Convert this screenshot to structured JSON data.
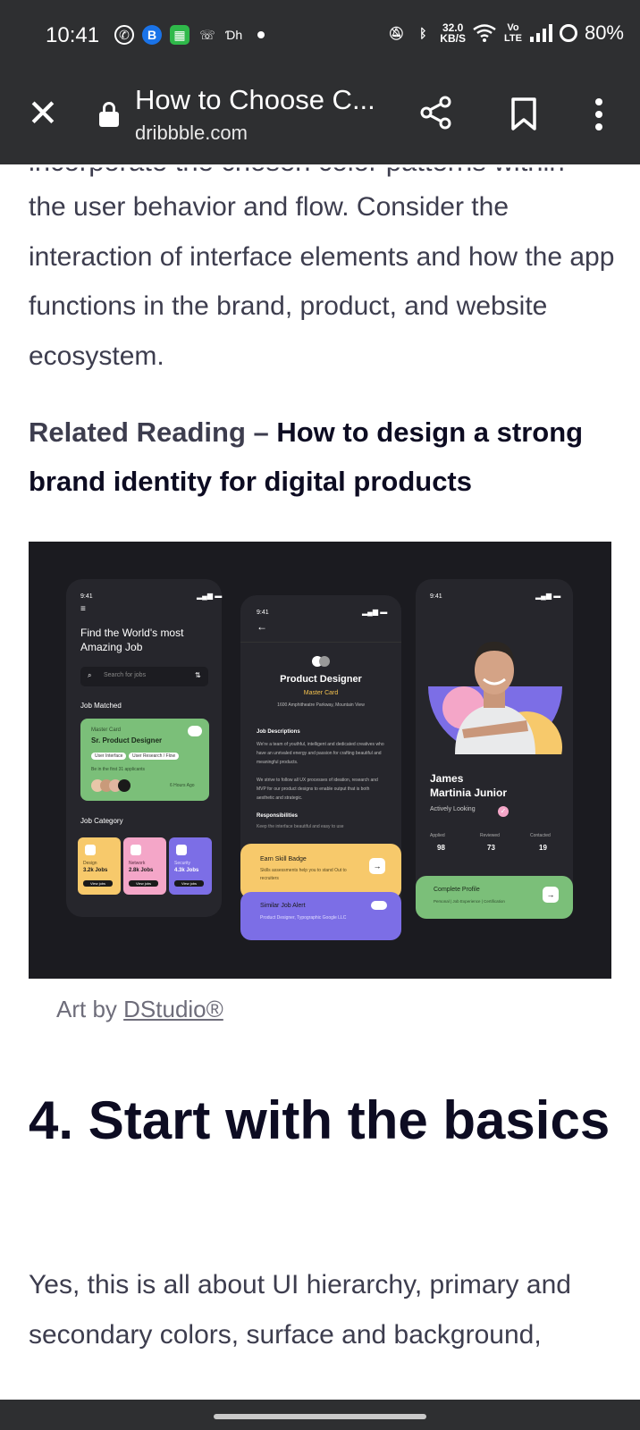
{
  "status_bar": {
    "time": "10:41",
    "speed_value": "32.0",
    "speed_unit": "KB/S",
    "network_label": "Vo LTE",
    "battery": "80%",
    "icons_left": [
      "whatsapp-icon",
      "b-app-icon",
      "calculator-icon",
      "phone-icon",
      "dh-icon"
    ],
    "dh_text": "Ɗh"
  },
  "toolbar": {
    "close_icon": "close-icon",
    "page_title": "How to Choose C...",
    "url": "dribbble.com"
  },
  "article": {
    "cut_line": "incorporate the chosen color patterns within",
    "para1": "the user behavior and flow. Consider the interaction of interface elements and how the app functions in the brand, product, and website ecosystem.",
    "related_prefix": "Related Reading – ",
    "related_link": "How to design a strong brand identity for digital products",
    "caption_prefix": "Art by ",
    "caption_link": "DStudio®",
    "heading": "4. Start with the basics",
    "para2": "Yes, this is all about UI hierarchy, primary and secondary colors, surface and background,"
  },
  "hero": {
    "phone1": {
      "time": "9:41",
      "title": "Find the World's most Amazing Job",
      "search_placeholder": "Search for jobs",
      "section": "Job Matched",
      "card_company": "Master Card",
      "card_title": "Sr. Product Designer",
      "tags": [
        "User Interface",
        "User Research / Flow"
      ],
      "note": "Be in the first 31 applicants",
      "posted": "6 Hours Ago",
      "category_title": "Job Category",
      "categories": [
        {
          "name": "Design",
          "jobs": "3.2k Jobs",
          "color": "#f7c96b"
        },
        {
          "name": "Network",
          "jobs": "2.8k Jobs",
          "color": "#f4a6c8"
        },
        {
          "name": "Security",
          "jobs": "4.3k Jobs",
          "color": "#7c6ee6"
        }
      ],
      "view_label": "View jobs"
    },
    "phone2": {
      "time": "9:41",
      "title": "Product Designer",
      "company": "Master Card",
      "address": "1600 Amphitheatre Parkway, Mountain View",
      "desc_title": "Job Descriptions",
      "desc": "We're a team of youthful, intelligent and dedicated creatives who have an unrivaled energy and passion for crafting beautiful and meaningful products.",
      "desc2": "We strive to follow all UX processes of ideation, research and MVP for our product designs to enable output that is both aesthetic and strategic.",
      "resp_title": "Responsibilities",
      "resp": "Keep the interface beautiful and easy to use",
      "badge_title": "Earn Skill Badge",
      "badge_text": "Skills assessments help you to stand Out to recruiters",
      "alert_title": "Similar Job Alert",
      "alert_text": "Product Designer, Typographic Google LLC"
    },
    "phone3": {
      "time": "9:41",
      "first_name": "James",
      "last_name": "Martinia Junior",
      "status": "Actively Looking",
      "stats": [
        {
          "label": "Applied",
          "value": "98"
        },
        {
          "label": "Reviewed",
          "value": "73"
        },
        {
          "label": "Contacted",
          "value": "19"
        }
      ],
      "complete_title": "Complete Profile",
      "complete_text": "Personal | Job Experience | Certification"
    }
  }
}
